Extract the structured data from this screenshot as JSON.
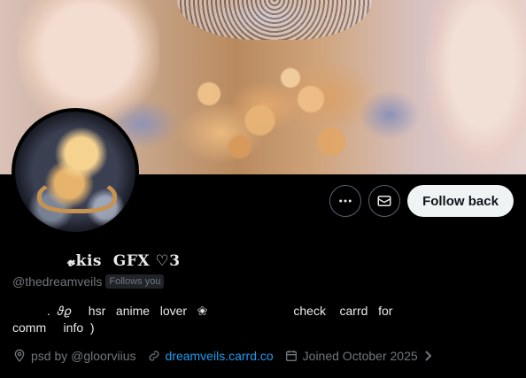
{
  "profile": {
    "display_name": "𝓿kis  GFX ♡3",
    "handle": "@thedreamveils",
    "follows_you": "Follows you",
    "bio_line1": "          .  𝜗𝜚     hsr   anime   lover   ❀                         check    carrd   for",
    "bio_line2": "comm     info  )",
    "location": "psd  by  @gloorviius",
    "website": "dreamveils.carrd.co",
    "joined": "Joined October 2025"
  },
  "actions": {
    "more_icon": "more-horizontal-icon",
    "message_icon": "mail-icon",
    "follow_label": "Follow back"
  },
  "colors": {
    "background": "#000000",
    "text_primary": "#e7e9ea",
    "text_secondary": "#71767b",
    "link": "#1d9bf0",
    "follow_button_bg": "#eff3f4"
  }
}
